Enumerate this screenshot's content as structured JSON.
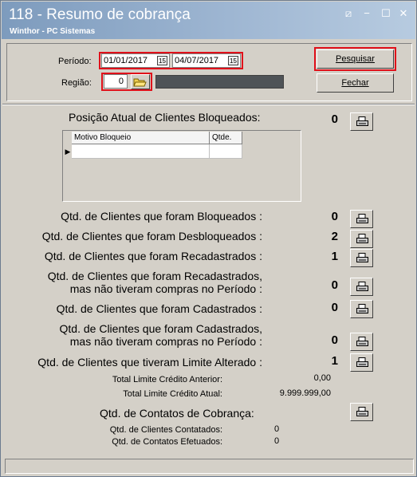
{
  "window": {
    "title": "118 - Resumo de cobrança",
    "subtitle": "Winthor - PC Sistemas",
    "controls": {
      "pin": "⧄",
      "minimize": "−",
      "maximize": "☐",
      "close": "✕"
    }
  },
  "filters": {
    "periodo_label": "Período:",
    "data_inicial": "01/01/2017",
    "data_final": "04/07/2017",
    "calendar_icon_label": "15",
    "regiao_label": "Região:",
    "regiao_value": "0",
    "regiao_descricao": ""
  },
  "buttons": {
    "pesquisar": "Pesquisar",
    "fechar": "Fechar"
  },
  "bloqueados": {
    "title": "Posição Atual de Clientes Bloqueados:",
    "value": "0",
    "grid_columns": [
      "Motivo Bloqueio",
      "Qtde."
    ],
    "grid_indicator": "▶"
  },
  "rows": [
    {
      "label": "Qtd. de Clientes que foram Bloqueados :",
      "value": "0"
    },
    {
      "label": "Qtd. de Clientes que foram Desbloqueados :",
      "value": "2"
    },
    {
      "label": "Qtd. de Clientes que foram Recadastrados :",
      "value": "1"
    },
    {
      "label_line1": "Qtd. de Clientes que foram Recadastrados,",
      "label_line2": "mas não tiveram compras no Período :",
      "value": "0"
    },
    {
      "label": "Qtd. de Clientes que foram Cadastrados :",
      "value": "0"
    },
    {
      "label_line1": "Qtd. de Clientes que foram Cadastrados,",
      "label_line2": "mas não tiveram compras no Período :",
      "value": "0"
    },
    {
      "label": "Qtd. de Clientes que tiveram Limite Alterado :",
      "value": "1"
    }
  ],
  "limites": {
    "anterior_label": "Total Limite Crédito Anterior:",
    "anterior_value": "0,00",
    "atual_label": "Total Limite Crédito Atual:",
    "atual_value": "9.999.999,00"
  },
  "contatos": {
    "title": "Qtd. de Contatos de Cobrança:",
    "contatados_label": "Qtd. de Clientes Contatados:",
    "contatados_value": "0",
    "efetuados_label": "Qtd. de Contatos Efetuados:",
    "efetuados_value": "0"
  },
  "colors": {
    "highlight": "#e0101a",
    "titlebar": "#8aa6c6",
    "face": "#d4d0c8"
  }
}
